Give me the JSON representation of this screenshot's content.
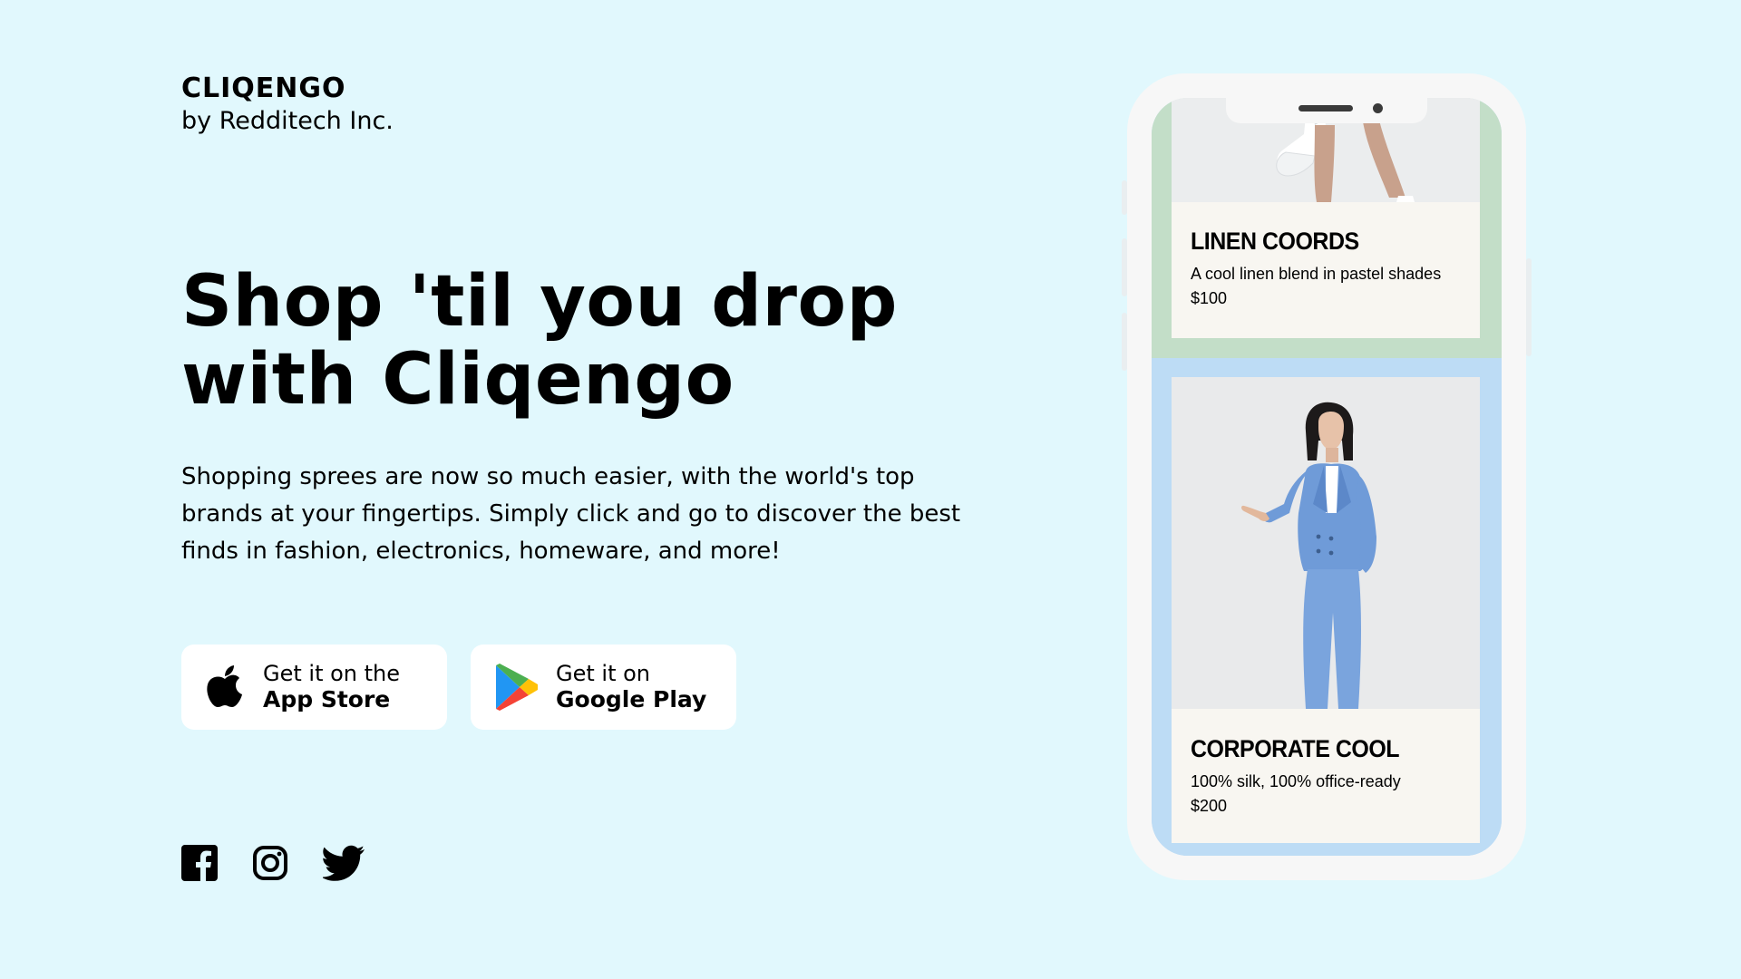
{
  "brand": {
    "name": "CLIQENGO",
    "byline": "by Redditech Inc."
  },
  "hero": {
    "headline_line1": "Shop 'til you drop",
    "headline_line2": "with Cliqengo",
    "description": "Shopping sprees are now so much easier, with the world's top brands at your fingertips. Simply click and go to discover the best finds in fashion, electronics, homeware, and more!"
  },
  "store_buttons": {
    "app_store": {
      "line1": "Get it on the",
      "line2": "App Store",
      "icon": "apple-icon"
    },
    "google_play": {
      "line1": "Get it on",
      "line2": "Google Play",
      "icon": "google-play-icon"
    }
  },
  "social": [
    "facebook-icon",
    "instagram-icon",
    "twitter-icon"
  ],
  "phone": {
    "products": [
      {
        "title": "LINEN COORDS",
        "description": "A cool linen blend in pastel shades",
        "price": "$100",
        "background": "#c3dec8"
      },
      {
        "title": "CORPORATE COOL",
        "description": "100% silk, 100% office-ready",
        "price": "$200",
        "background": "#bddcf5"
      }
    ]
  },
  "colors": {
    "page_background": "#e1f8fd",
    "card_background": "#f8f6f1",
    "phone_frame": "#f7f7f7"
  }
}
